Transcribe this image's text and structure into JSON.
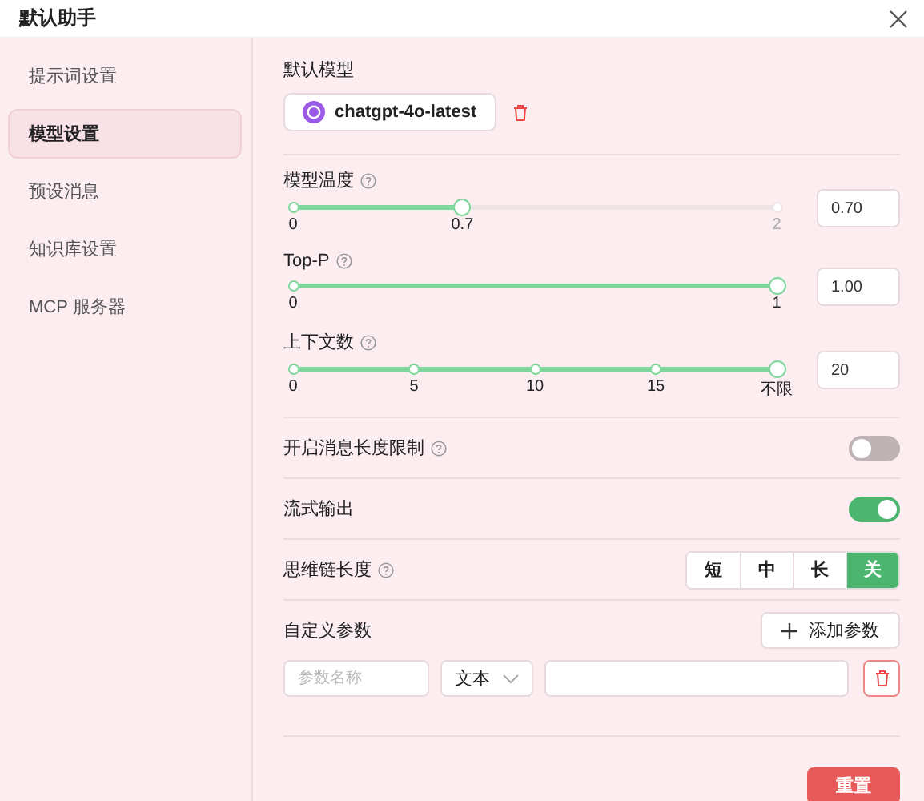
{
  "window": {
    "title": "默认助手"
  },
  "sidebar": {
    "items": [
      {
        "label": "提示词设置",
        "selected": false
      },
      {
        "label": "模型设置",
        "selected": true
      },
      {
        "label": "预设消息",
        "selected": false
      },
      {
        "label": "知识库设置",
        "selected": false
      },
      {
        "label": "MCP 服务器",
        "selected": false
      }
    ]
  },
  "default_model": {
    "label": "默认模型",
    "model": "chatgpt-4o-latest"
  },
  "sliders": [
    {
      "label": "模型温度",
      "help": true,
      "level": 0.35,
      "thumb_label": "0.7",
      "marks": [
        "0",
        "2"
      ],
      "value": "0.70"
    },
    {
      "label": "Top-P",
      "help": true,
      "level": 1,
      "marks": [
        "0",
        "1"
      ],
      "value": "1.00"
    },
    {
      "label": "上下文数",
      "help": true,
      "level": 1,
      "marks": [
        "0",
        "5",
        "10",
        "15",
        "不限"
      ],
      "value": "20"
    }
  ],
  "toggles": [
    {
      "label": "开启消息长度限制",
      "help": true,
      "on": false
    },
    {
      "label": "流式输出",
      "help": false,
      "on": true
    }
  ],
  "thinking": {
    "label": "思维链长度",
    "help": true,
    "options": [
      {
        "label": "短",
        "selected": false
      },
      {
        "label": "中",
        "selected": false
      },
      {
        "label": "长",
        "selected": false
      },
      {
        "label": "关",
        "selected": true
      }
    ]
  },
  "custom_params": {
    "label": "自定义参数",
    "add_button": "添加参数",
    "name_placeholder": "参数名称",
    "type": "文本"
  },
  "reset_button": "重置"
}
